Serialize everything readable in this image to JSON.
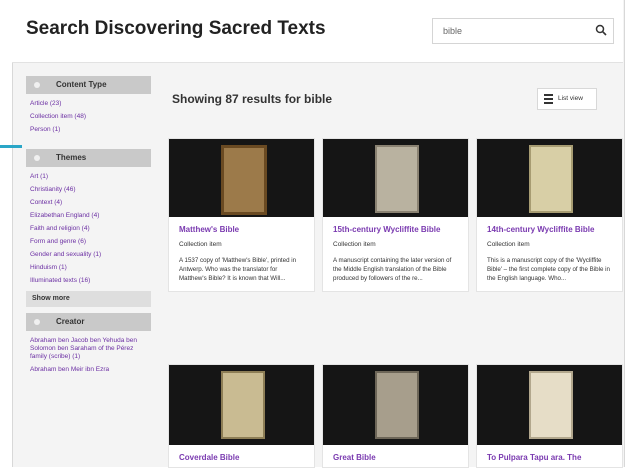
{
  "header": {
    "title": "Search Discovering Sacred Texts",
    "search_value": "bible"
  },
  "sidebar": {
    "content_type": {
      "heading": "Content Type",
      "items": [
        "Article (23)",
        "Collection item (48)",
        "Person (1)"
      ]
    },
    "themes": {
      "heading": "Themes",
      "items": [
        "Art (1)",
        "Christianity (46)",
        "Context (4)",
        "Elizabethan England (4)",
        "Faith and religion (4)",
        "Form and genre (6)",
        "Gender and sexuality (1)",
        "Hinduism (1)",
        "Illuminated texts (16)"
      ]
    },
    "show_more": "Show more",
    "creator": {
      "heading": "Creator",
      "items": [
        "Abraham ben Jacob ben Yehuda ben Solomon ben Saraham of the Pérez family (scribe) (1)",
        "Abraham ben Meir ibn Ezra"
      ]
    }
  },
  "main": {
    "results_heading": "Showing 87 results for bible",
    "list_view_label": "List view",
    "cards": [
      {
        "title": "Matthew's Bible",
        "type": "Collection item",
        "desc": "A 1537 copy of 'Matthew's Bible', printed in Antwerp. Who was the translator for Matthew's Bible? It is known that Will..."
      },
      {
        "title": "15th-century Wycliffite Bible",
        "type": "Collection item",
        "desc": "A manuscript containing the later version of the Middle English translation of the Bible produced by followers of the re..."
      },
      {
        "title": "14th-century Wycliffite Bible",
        "type": "Collection item",
        "desc": "This is a manuscript copy of the 'Wycliffite Bible' – the first complete copy of the Bible in the English language. Who..."
      },
      {
        "title": "Coverdale Bible"
      },
      {
        "title": "Great Bible"
      },
      {
        "title": "To Pulpara Tapu ara. The"
      }
    ]
  },
  "colors": {
    "link": "#6b2fa3",
    "card_title": "#7a3ab0",
    "accent": "#2aa6c7",
    "facet_heading_bg": "#c9c9c9"
  }
}
